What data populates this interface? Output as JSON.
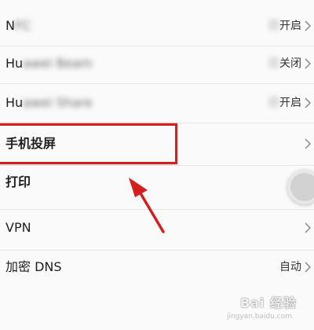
{
  "rows": [
    {
      "label_visible": "N",
      "label_blurred": "FC",
      "value_blurred": "已",
      "value": "开启"
    },
    {
      "label_visible": "Hu",
      "label_blurred": "awei Beam",
      "value_blurred": "已",
      "value": "关闭"
    },
    {
      "label_visible": "Hu",
      "label_blurred": "awei Share",
      "value_blurred": "已",
      "value": "开启"
    },
    {
      "label": "手机投屏"
    },
    {
      "label": "打印"
    },
    {
      "label": "VPN"
    },
    {
      "label": "加密 DNS",
      "value": "自动"
    }
  ],
  "watermark": {
    "text": "Bai 经验",
    "sub": "jingyan.baidu.com"
  },
  "colors": {
    "highlight": "#d41f1f",
    "arrow": "#d41f1f"
  },
  "icons": {
    "chevron": "chevron-right-icon",
    "pointer": "arrow-pointer-icon"
  }
}
